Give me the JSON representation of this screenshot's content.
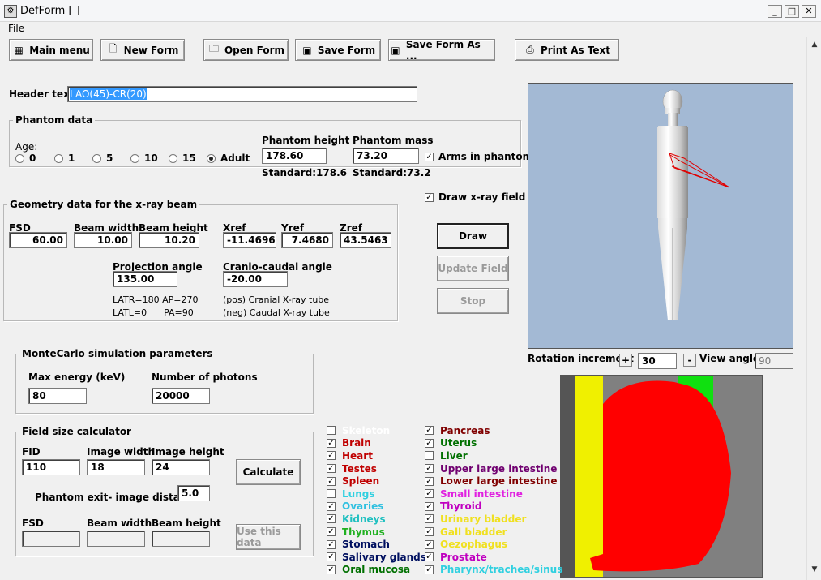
{
  "window": {
    "title": "DefForm  [ ]"
  },
  "menu": {
    "file": "File"
  },
  "toolbar": {
    "main_menu": "Main menu",
    "new_form": "New Form",
    "open_form": "Open Form",
    "save_form": "Save Form",
    "save_form_as": "Save Form As ...",
    "print_as_text": "Print As Text"
  },
  "header": {
    "label": "Header text",
    "value": "LAO(45)-CR(20)"
  },
  "phantom": {
    "group_title": "Phantom data",
    "age_label": "Age:",
    "ages": [
      "0",
      "1",
      "5",
      "10",
      "15",
      "Adult"
    ],
    "selected_age": "Adult",
    "height_label": "Phantom height",
    "height_value": "178.60",
    "height_standard": "Standard:178.6",
    "mass_label": "Phantom mass",
    "mass_value": "73.20",
    "mass_standard": "Standard:73.2",
    "arms_label": "Arms in phantom",
    "arms_checked": true
  },
  "draw_xray_field": {
    "label": "Draw x-ray field",
    "checked": true
  },
  "geometry": {
    "group_title": "Geometry data for the x-ray beam",
    "fsd_label": "FSD",
    "fsd_value": "60.00",
    "beam_width_label": "Beam width",
    "beam_width_value": "10.00",
    "beam_height_label": "Beam height",
    "beam_height_value": "10.20",
    "xref_label": "Xref",
    "xref_value": "-11.4696",
    "yref_label": "Yref",
    "yref_value": "7.4680",
    "zref_label": "Zref",
    "zref_value": "43.5463",
    "proj_label": "Projection angle",
    "proj_value": "135.00",
    "cc_label": "Cranio-caudal angle",
    "cc_value": "-20.00",
    "note1": "LATR=180  AP=270",
    "note2": "LATL=0      PA=90",
    "note3": "(pos) Cranial X-ray tube",
    "note4": "(neg) Caudal X-ray tube"
  },
  "actions": {
    "draw": "Draw",
    "update_field": "Update Field",
    "stop": "Stop"
  },
  "montecarlo": {
    "group_title": "MonteCarlo simulation parameters",
    "max_energy_label": "Max energy (keV)",
    "max_energy_value": "80",
    "photons_label": "Number of photons",
    "photons_value": "20000"
  },
  "fieldsize": {
    "group_title": "Field size calculator",
    "fid_label": "FID",
    "fid_value": "110",
    "image_width_label": "Image width",
    "image_width_value": "18",
    "image_height_label": "Image height",
    "image_height_value": "24",
    "calculate": "Calculate",
    "exit_label": "Phantom exit- image distance:",
    "exit_value": "5.0",
    "fsd_label": "FSD",
    "beam_width_label": "Beam width",
    "beam_height_label": "Beam height",
    "use_data": "Use this data"
  },
  "rotation": {
    "label": "Rotation increment",
    "plus": "+",
    "value": "30",
    "minus": "-",
    "view_label": "View angle",
    "view_value": "90"
  },
  "organs_left": [
    {
      "name": "Skeleton",
      "checked": false,
      "color": "#ffffff"
    },
    {
      "name": "Brain",
      "checked": true,
      "color": "#c00000"
    },
    {
      "name": "Heart",
      "checked": true,
      "color": "#c00000"
    },
    {
      "name": "Testes",
      "checked": true,
      "color": "#c00000"
    },
    {
      "name": "Spleen",
      "checked": true,
      "color": "#c00000"
    },
    {
      "name": "Lungs",
      "checked": false,
      "color": "#30d0e0"
    },
    {
      "name": "Ovaries",
      "checked": true,
      "color": "#30c0e0"
    },
    {
      "name": "Kidneys",
      "checked": true,
      "color": "#20c0c0"
    },
    {
      "name": "Thymus",
      "checked": true,
      "color": "#20b020"
    },
    {
      "name": "Stomach",
      "checked": true,
      "color": "#001060"
    },
    {
      "name": "Salivary glands",
      "checked": true,
      "color": "#001060"
    },
    {
      "name": "Oral mucosa",
      "checked": true,
      "color": "#007000"
    }
  ],
  "organs_right": [
    {
      "name": "Pancreas",
      "checked": true,
      "color": "#800000"
    },
    {
      "name": "Uterus",
      "checked": true,
      "color": "#007000"
    },
    {
      "name": "Liver",
      "checked": false,
      "color": "#007000"
    },
    {
      "name": "Upper large intestine",
      "checked": true,
      "color": "#700070"
    },
    {
      "name": "Lower large intestine",
      "checked": true,
      "color": "#800000"
    },
    {
      "name": "Small intestine",
      "checked": true,
      "color": "#e020e0"
    },
    {
      "name": "Thyroid",
      "checked": true,
      "color": "#c000c0"
    },
    {
      "name": "Urinary bladder",
      "checked": true,
      "color": "#f0e020"
    },
    {
      "name": "Gall bladder",
      "checked": true,
      "color": "#f0e020"
    },
    {
      "name": "Oezophagus",
      "checked": true,
      "color": "#f0e020"
    },
    {
      "name": "Prostate",
      "checked": true,
      "color": "#c000c0"
    },
    {
      "name": "Pharynx/trachea/sinus",
      "checked": true,
      "color": "#30d0e0"
    }
  ]
}
